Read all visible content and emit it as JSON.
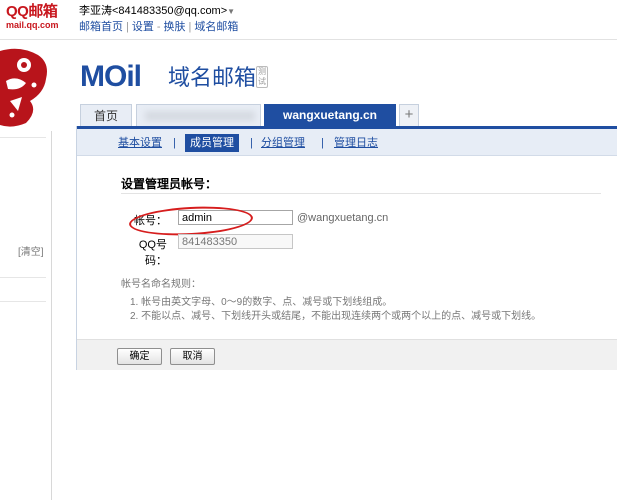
{
  "top": {
    "brand": "QQ邮箱",
    "brand_domain": "mail.qq.com",
    "user_name": "李亚涛<841483350@qq.com>",
    "links": [
      "邮箱首页",
      "设置",
      "换肤",
      "域名邮箱"
    ]
  },
  "sidebar": {
    "clear_link": "[清空]"
  },
  "mail_logo": {
    "logo_text": "MOil",
    "title": "域名邮箱",
    "badge": "测试"
  },
  "tabs": {
    "home": "首页",
    "active": "wangxuetang.cn",
    "add": "+"
  },
  "subnav": {
    "items": [
      "基本设置",
      "成员管理",
      "分组管理",
      "管理日志"
    ],
    "active_index": 1
  },
  "form": {
    "title": "设置管理员帐号：",
    "account_label": "帐号：",
    "account_value": "admin",
    "domain_suffix": "@wangxuetang.cn",
    "qq_label": "QQ号码：",
    "qq_value": "841483350"
  },
  "rules": {
    "title": "帐号名命名规则：",
    "items": [
      "1. 帐号由英文字母、0～9的数字、点、减号或下划线组成。",
      "2. 不能以点、减号、下划线开头或结尾，不能出现连续两个或两个以上的点、减号或下划线。"
    ]
  },
  "buttons": {
    "ok": "确定",
    "cancel": "取消"
  },
  "colors": {
    "brand_red": "#c8161d",
    "brand_blue": "#1f4ea1",
    "highlight": "#d61d1d"
  }
}
